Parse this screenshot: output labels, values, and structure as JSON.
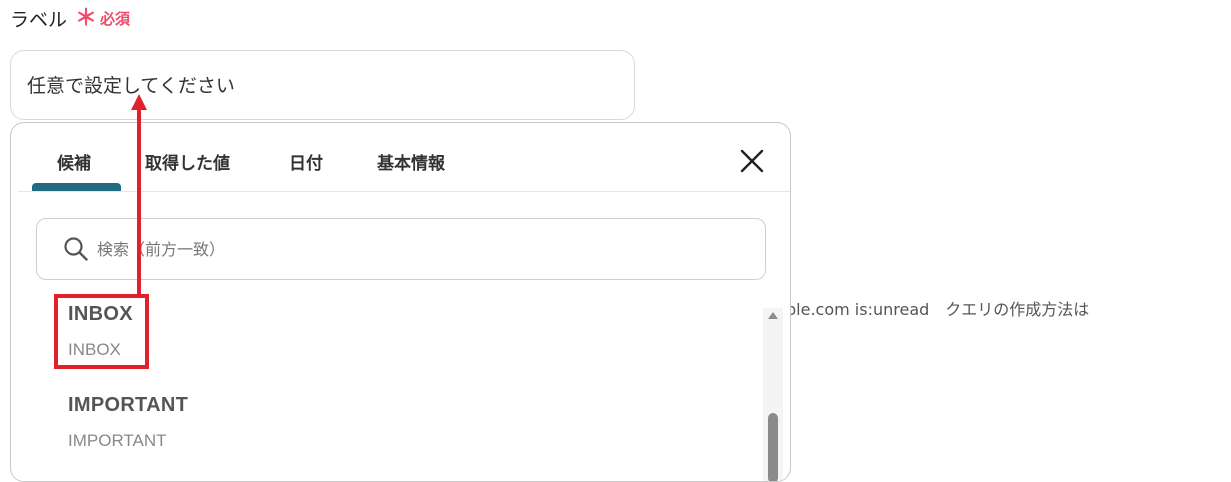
{
  "field": {
    "label": "ラベル",
    "required_mark": "＊",
    "required_text": "必須",
    "input_value": "任意で設定してください"
  },
  "background_hint": "ple.com is:unread　クエリの作成方法は",
  "dropdown": {
    "tabs": [
      {
        "label": "候補",
        "active": true
      },
      {
        "label": "取得した値",
        "active": false
      },
      {
        "label": "日付",
        "active": false
      },
      {
        "label": "基本情報",
        "active": false
      }
    ],
    "close_icon": "close-icon",
    "search": {
      "placeholder": "検索（前方一致）",
      "value": "",
      "icon": "search-icon"
    },
    "options": [
      {
        "title": "INBOX",
        "subtitle": "INBOX",
        "highlighted": true
      },
      {
        "title": "IMPORTANT",
        "subtitle": "IMPORTANT",
        "highlighted": false
      }
    ]
  },
  "colors": {
    "accent_tab": "#1f6b82",
    "required": "#ef4c6a",
    "annotation": "#e0202b"
  }
}
